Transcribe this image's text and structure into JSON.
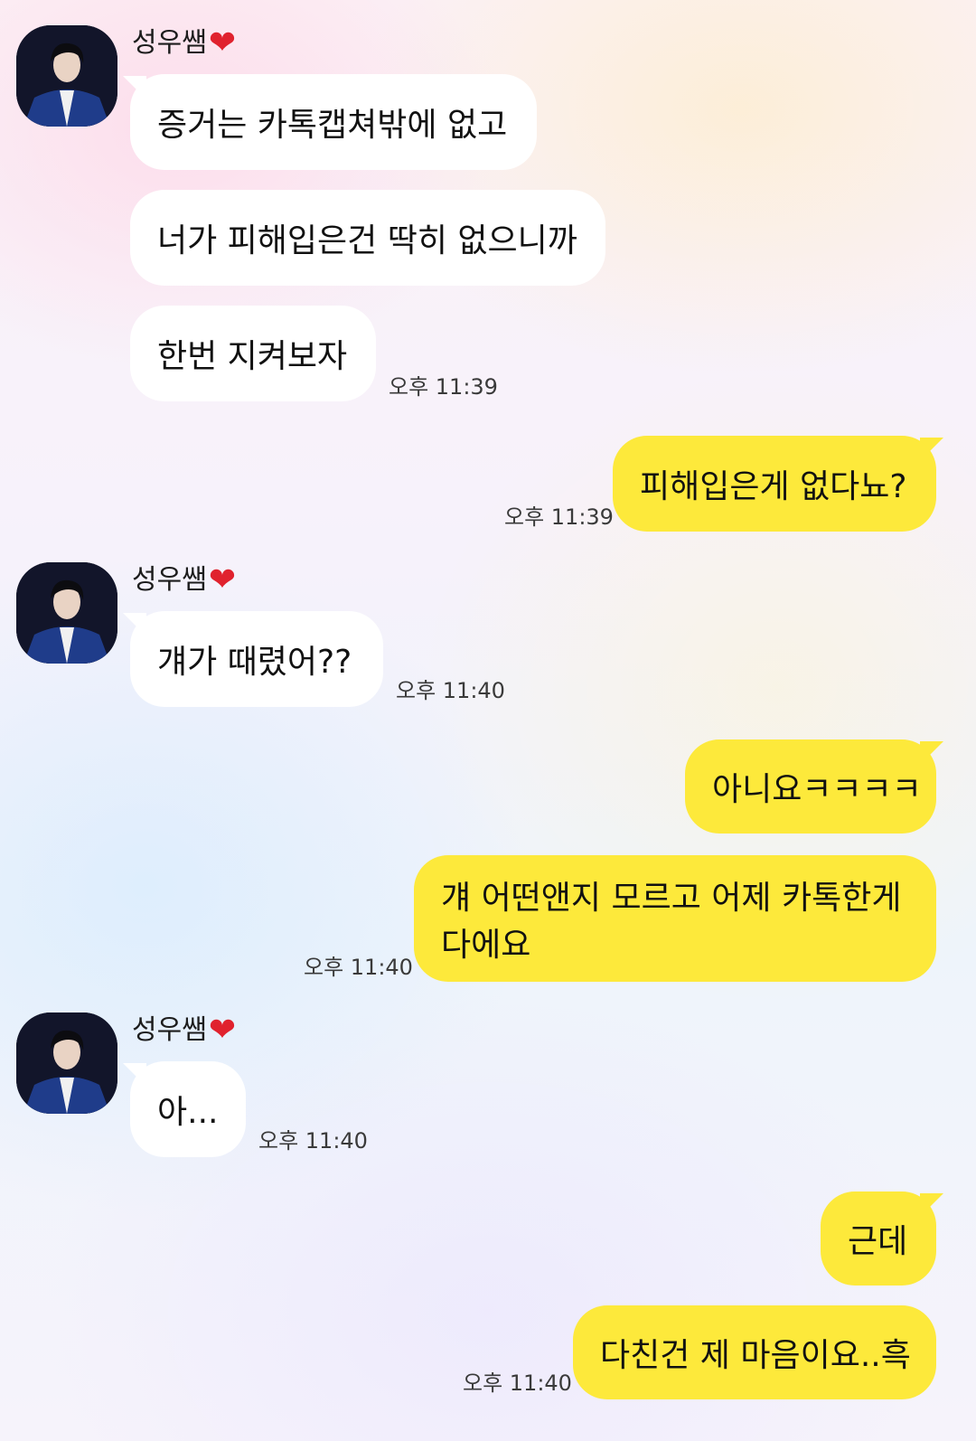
{
  "contact": {
    "name": "성우쌤",
    "heart_icon": "heart-icon",
    "avatar_icon": "profile-photo-icon"
  },
  "messages": [
    {
      "side": "recv",
      "text": "증거는 카톡캡쳐밖에 없고"
    },
    {
      "side": "recv",
      "text": "너가 피해입은건 딱히 없으니까"
    },
    {
      "side": "recv",
      "text": "한번 지켜보자",
      "time": "오후 11:39"
    },
    {
      "side": "sent",
      "text": "피해입은게 없다뇨?",
      "time": "오후 11:39"
    },
    {
      "side": "recv",
      "text": "걔가 때렸어??",
      "time": "오후 11:40"
    },
    {
      "side": "sent",
      "text": "아니요ㅋㅋㅋㅋ"
    },
    {
      "side": "sent",
      "text": "걔 어떤앤지 모르고 어제 카톡한게 다에요",
      "time": "오후 11:40"
    },
    {
      "side": "recv",
      "text": "아...",
      "time": "오후 11:40"
    },
    {
      "side": "sent",
      "text": "근데"
    },
    {
      "side": "sent",
      "text": "다친건 제 마음이요..흑",
      "time": "오후 11:40"
    }
  ],
  "colors": {
    "sent_bubble": "#fde93b",
    "recv_bubble": "#ffffff",
    "heart": "#e0222e"
  }
}
